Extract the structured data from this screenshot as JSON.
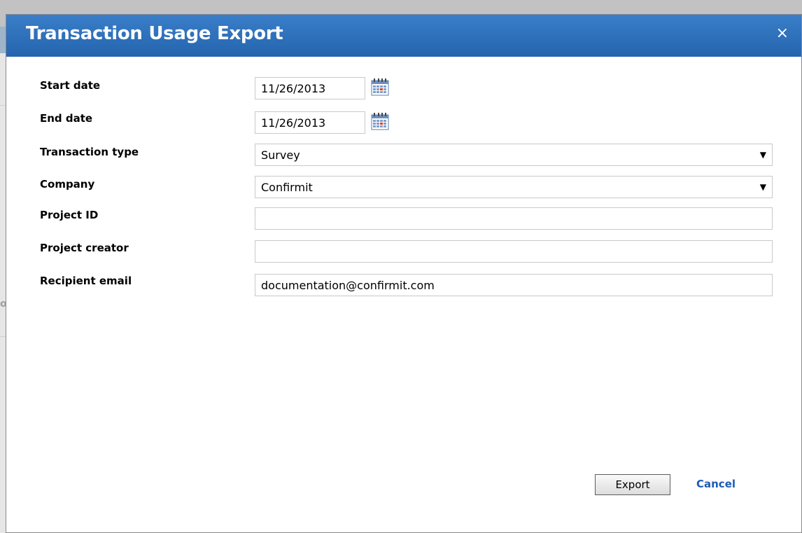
{
  "dialog": {
    "title": "Transaction Usage Export",
    "close_label": "×"
  },
  "form": {
    "start_date": {
      "label": "Start date",
      "value": "11/26/2013"
    },
    "end_date": {
      "label": "End date",
      "value": "11/26/2013"
    },
    "transaction_type": {
      "label": "Transaction type",
      "value": "Survey"
    },
    "company": {
      "label": "Company",
      "value": "Confirmit"
    },
    "project_id": {
      "label": "Project ID",
      "value": ""
    },
    "project_creator": {
      "label": "Project creator",
      "value": ""
    },
    "recipient_email": {
      "label": "Recipient email",
      "value": "documentation@confirmit.com"
    }
  },
  "actions": {
    "export_label": "Export",
    "cancel_label": "Cancel"
  },
  "background": {
    "fragment_text": "or"
  },
  "icons": {
    "calendar": "calendar-icon",
    "dropdown": "chevron-down-icon",
    "close": "close-icon"
  },
  "colors": {
    "titlebar": "#2a6bb5",
    "link": "#1f5bb5"
  }
}
